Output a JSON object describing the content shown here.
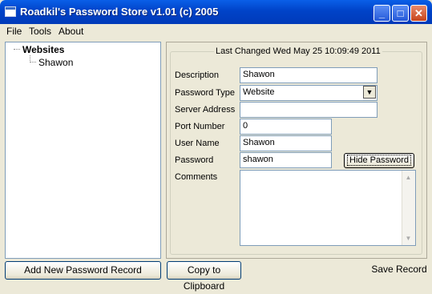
{
  "window": {
    "title": "Roadkil's Password Store v1.01 (c) 2005"
  },
  "menu": {
    "file": "File",
    "tools": "Tools",
    "about": "About"
  },
  "tree": {
    "root": "Websites",
    "child": "Shawon"
  },
  "buttons": {
    "add": "Add New Password Record",
    "copy": "Copy to Clipboard",
    "save": "Save Record",
    "hide_password": "Hide Password"
  },
  "record": {
    "last_changed": "Last Changed Wed May 25 10:09:49 2011",
    "labels": {
      "description": "Description",
      "password_type": "Password Type",
      "server_address": "Server Address",
      "port_number": "Port Number",
      "user_name": "User Name",
      "password": "Password",
      "comments": "Comments"
    },
    "values": {
      "description": "Shawon",
      "password_type": "Website",
      "server_address": "",
      "port_number": "0",
      "user_name": "Shawon",
      "password": "shawon",
      "comments": ""
    }
  }
}
